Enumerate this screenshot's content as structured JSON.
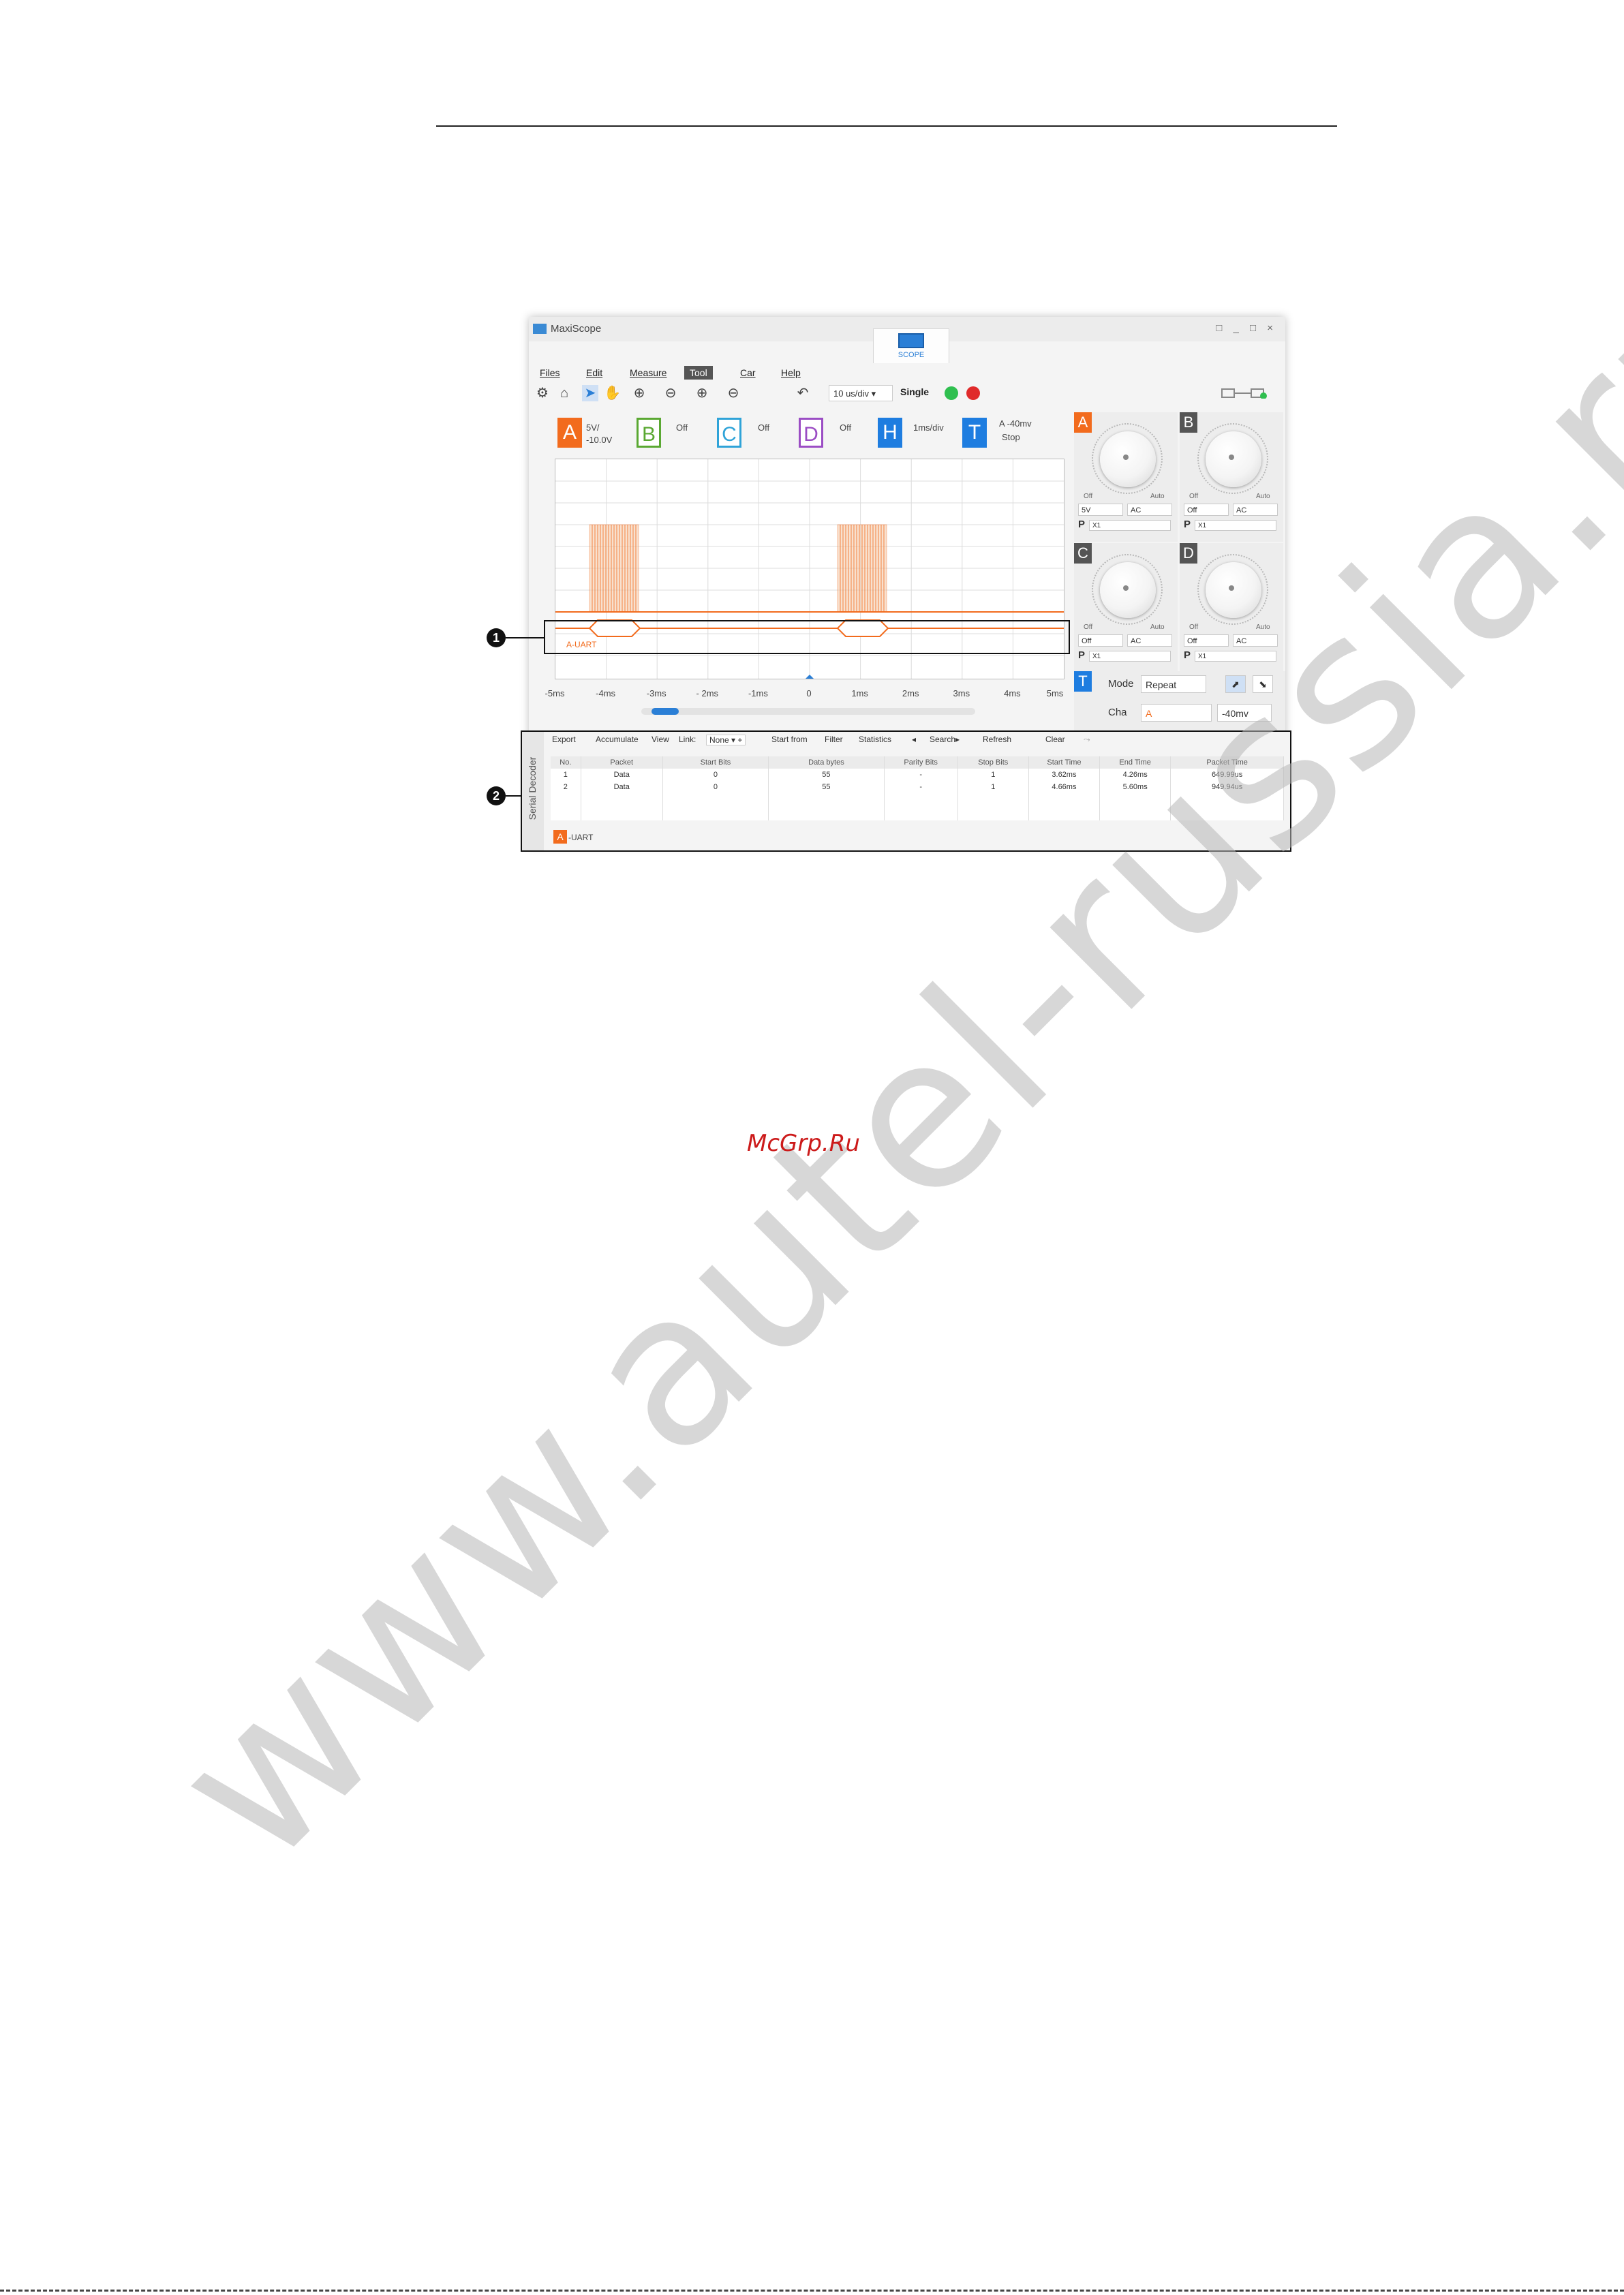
{
  "window": {
    "title": "MaxiScope",
    "controls": "□ _ □ ×",
    "scope_tab": "SCOPE"
  },
  "menu": [
    "Files",
    "Edit",
    "Measure",
    "Tool",
    "Car",
    "Help"
  ],
  "menu_active": "Tool",
  "toolbar": {
    "timebase": "10 us/div ▾",
    "single": "Single"
  },
  "channels": {
    "A": {
      "label": "A",
      "value": "5V/\n-10.0V",
      "color": "#f26b1d"
    },
    "B": {
      "label": "B",
      "value": "Off",
      "color": "#5aa832"
    },
    "C": {
      "label": "C",
      "value": "Off",
      "color": "#2fa3d8"
    },
    "D": {
      "label": "D",
      "value": "Off",
      "color": "#9b4dc4"
    },
    "H": {
      "label": "H",
      "value": "1ms/div",
      "color": "#1e7de0"
    },
    "T": {
      "label": "T",
      "value_top": "A  -40mv",
      "value_bottom": "Stop",
      "color": "#1e7de0"
    }
  },
  "plot": {
    "decode_label": "A-UART",
    "x_ticks": [
      "-5ms",
      "-4ms",
      "-3ms",
      "- 2ms",
      "-1ms",
      "0",
      "1ms",
      "2ms",
      "3ms",
      "4ms",
      "5ms"
    ]
  },
  "knobs": [
    {
      "id": "A",
      "color": "#f26b1d",
      "off": "Off",
      "auto": "Auto",
      "range": "5V",
      "coupling": "AC",
      "probe_prefix": "P",
      "probe": "X1"
    },
    {
      "id": "B",
      "color": "#555555",
      "off": "Off",
      "auto": "Auto",
      "range": "Off",
      "coupling": "AC",
      "probe_prefix": "P",
      "probe": "X1"
    },
    {
      "id": "C",
      "color": "#555555",
      "off": "Off",
      "auto": "Auto",
      "range": "Off",
      "coupling": "AC",
      "probe_prefix": "P",
      "probe": "X1"
    },
    {
      "id": "D",
      "color": "#555555",
      "off": "Off",
      "auto": "Auto",
      "range": "Off",
      "coupling": "AC",
      "probe_prefix": "P",
      "probe": "X1"
    }
  ],
  "trigger": {
    "badge": "T",
    "mode_label": "Mode",
    "mode": "Repeat",
    "cha_label": "Cha",
    "cha": "A",
    "level": "-40mv"
  },
  "decoder": {
    "side_label": "Serial Decoder",
    "toolbar": [
      "Export",
      "Accumulate",
      "View",
      "Link:",
      "None ▾ +",
      "Start from",
      "Filter",
      "Statistics",
      "◂",
      "Search▸",
      "Refresh",
      "Clear"
    ],
    "columns": [
      "No.",
      "Packet",
      "Start Bits",
      "Data bytes",
      "Parity Bits",
      "Stop Bits",
      "Start Time",
      "End Time",
      "Packet Time"
    ],
    "rows": [
      [
        "1",
        "Data",
        "0",
        "55",
        "-",
        "1",
        "3.62ms",
        "4.26ms",
        "649.99us"
      ],
      [
        "2",
        "Data",
        "0",
        "55",
        "-",
        "1",
        "4.66ms",
        "5.60ms",
        "949.94us"
      ]
    ],
    "footer_badge": "A",
    "footer_text": "-UART"
  },
  "callouts": [
    "1",
    "2"
  ],
  "watermark": "www.autel-russia.ru",
  "mcgrp": "McGrp.Ru"
}
